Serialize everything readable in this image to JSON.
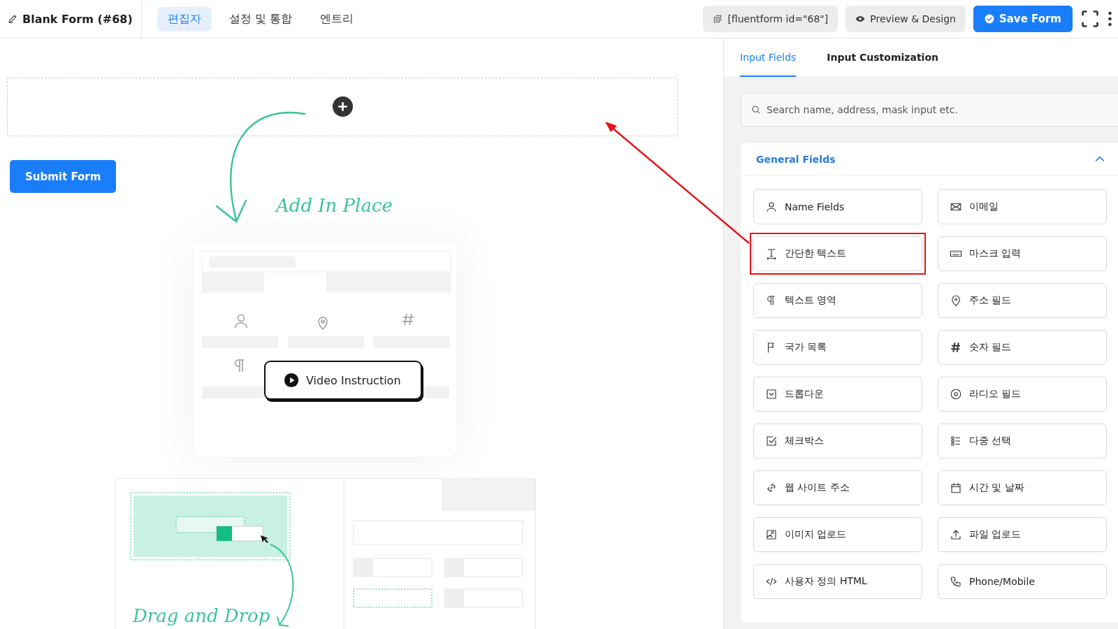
{
  "header": {
    "title": "Blank Form (#68)",
    "tabs": [
      {
        "label": "편집자",
        "selected": true
      },
      {
        "label": "설정 및 통합",
        "selected": false
      },
      {
        "label": "엔트리",
        "selected": false
      }
    ],
    "shortcode": "[fluentform id=\"68\"]",
    "preview_button": "Preview & Design",
    "save_button": "Save Form"
  },
  "canvas": {
    "submit_button": "Submit Form",
    "add_label": "Add In Place",
    "video_button": "Video Instruction",
    "drag_label": "Drag and Drop"
  },
  "panel": {
    "tabs": [
      {
        "label": "Input Fields",
        "selected": true
      },
      {
        "label": "Input Customization",
        "selected": false
      }
    ],
    "search": {
      "placeholder": "Search name, address, mask input etc."
    },
    "section": {
      "title": "General Fields",
      "expanded": true,
      "fields": [
        {
          "label": "Name Fields",
          "kind": "person",
          "highlighted": false
        },
        {
          "label": "이메일",
          "kind": "envelope",
          "highlighted": false
        },
        {
          "label": "간단한 텍스트",
          "kind": "text-input",
          "highlighted": true
        },
        {
          "label": "마스크 입력",
          "kind": "mask",
          "highlighted": false
        },
        {
          "label": "텍스트 영역",
          "kind": "textarea",
          "highlighted": false
        },
        {
          "label": "주소 필드",
          "kind": "address",
          "highlighted": false
        },
        {
          "label": "국가 목록",
          "kind": "country",
          "highlighted": false
        },
        {
          "label": "숫자 필드",
          "kind": "number",
          "highlighted": false
        },
        {
          "label": "드롭다운",
          "kind": "dropdown",
          "highlighted": false
        },
        {
          "label": "라디오 필드",
          "kind": "radio",
          "highlighted": false
        },
        {
          "label": "체크박스",
          "kind": "checkbox",
          "highlighted": false
        },
        {
          "label": "다중 선택",
          "kind": "multiselect",
          "highlighted": false
        },
        {
          "label": "웹 사이트 주소",
          "kind": "url",
          "highlighted": false
        },
        {
          "label": "시간 및 날짜",
          "kind": "datetime",
          "highlighted": false
        },
        {
          "label": "이미지 업로드",
          "kind": "image",
          "highlighted": false
        },
        {
          "label": "파일 업로드",
          "kind": "file",
          "highlighted": false
        },
        {
          "label": "사용자 정의 HTML",
          "kind": "html",
          "highlighted": false
        },
        {
          "label": "Phone/Mobile",
          "kind": "phone",
          "highlighted": false
        }
      ]
    }
  }
}
